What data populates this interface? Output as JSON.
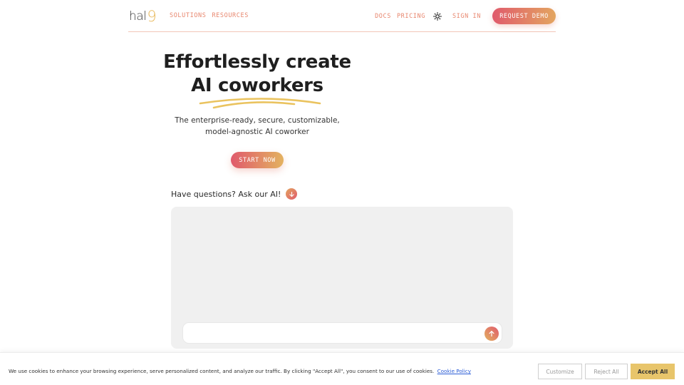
{
  "header": {
    "logo_text": "hal",
    "logo_accent": "9",
    "nav_left": [
      {
        "label": "SOLUTIONS"
      },
      {
        "label": "RESOURCES"
      }
    ],
    "nav_right": [
      {
        "label": "DOCS"
      },
      {
        "label": "PRICING"
      }
    ],
    "theme_icon": "sun-icon",
    "sign_in_label": "SIGN IN",
    "request_demo_label": "REQUEST DEMO"
  },
  "hero": {
    "title_line1": "Effortlessly create",
    "title_line2": "AI coworkers",
    "subtitle": "The enterprise-ready, secure, customizable, model-agnostic AI coworker",
    "cta_label": "START NOW"
  },
  "ask": {
    "label": "Have questions? Ask our AI!",
    "arrow_icon": "arrow-down-icon"
  },
  "chat": {
    "input_value": "",
    "input_placeholder": "",
    "send_icon": "arrow-up-icon"
  },
  "cookie": {
    "text": "We use cookies to enhance your browsing experience, serve personalized  content, and analyze our traffic. By clicking \"Accept All\", you consent to our use of cookies.",
    "link_label": "Cookie Policy",
    "customize_label": "Customize",
    "reject_label": "Reject All",
    "accept_label": "Accept All"
  },
  "colors": {
    "accent_pink": "#e05a6c",
    "accent_gold": "#e3b260",
    "nav_text": "#e8876f",
    "accept_button": "#e8c56b",
    "chat_panel_bg": "#f0f0f0"
  }
}
